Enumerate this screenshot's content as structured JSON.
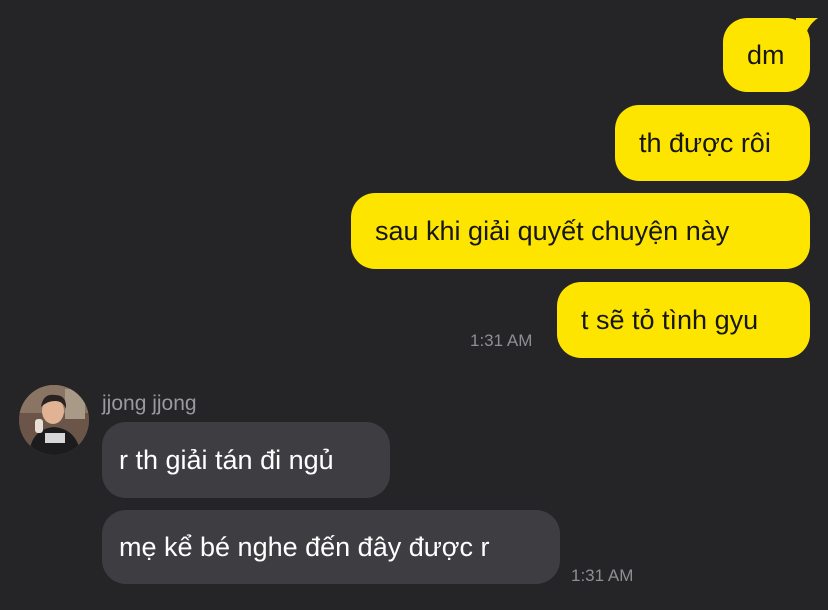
{
  "outgoing_messages": [
    {
      "text": "dm"
    },
    {
      "text": "th được rôi"
    },
    {
      "text": "sau khi giải quyết chuyện này"
    },
    {
      "text": "t sẽ tỏ tình gyu"
    }
  ],
  "outgoing_timestamp": "1:31 AM",
  "incoming": {
    "sender_name": "jjong jjong",
    "messages": [
      {
        "text": "r th giải tán đi ngủ"
      },
      {
        "text": "mẹ kể bé nghe đến đây được r"
      }
    ],
    "timestamp": "1:31 AM"
  },
  "colors": {
    "background": "#252528",
    "outgoing_bubble": "#FEE500",
    "incoming_bubble": "#3e3e42",
    "timestamp_text": "#8e8e93"
  }
}
